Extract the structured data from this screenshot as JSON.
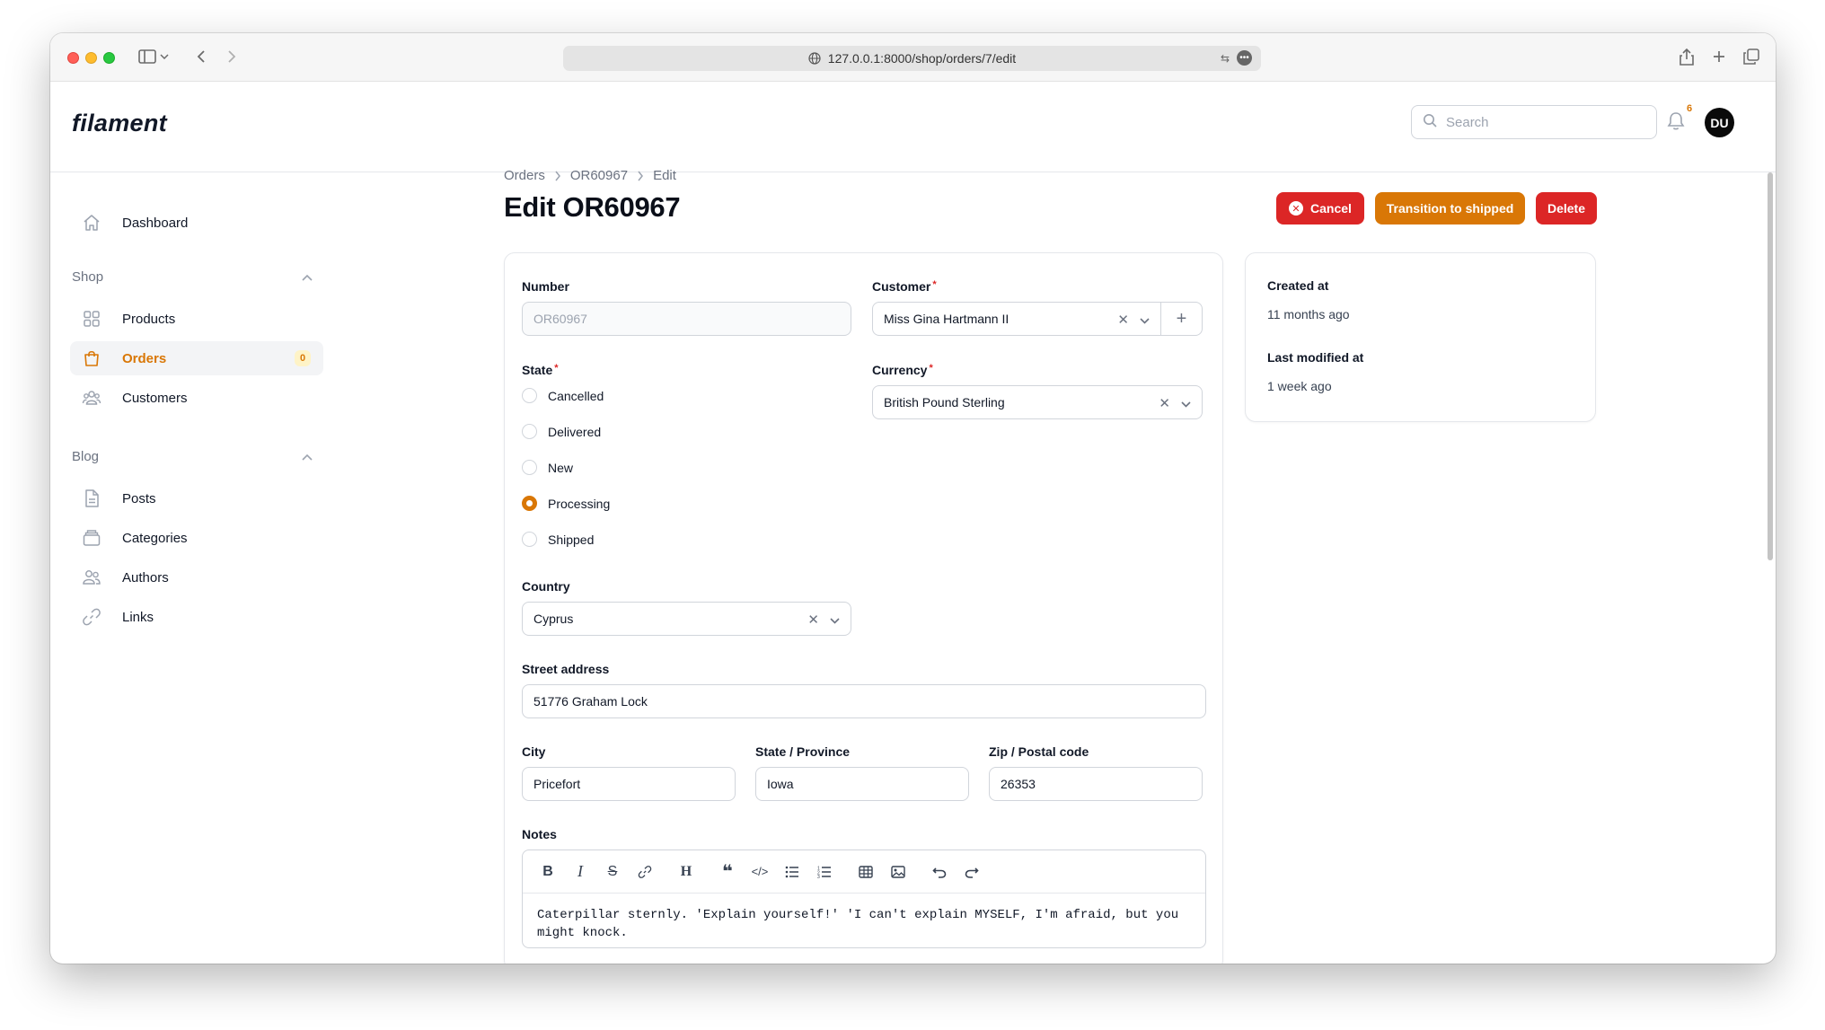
{
  "browser": {
    "url": "127.0.0.1:8000/shop/orders/7/edit"
  },
  "app": {
    "logo": "filament",
    "search_placeholder": "Search",
    "notification_count": "6",
    "avatar_initials": "DU"
  },
  "sidebar": {
    "dashboard": "Dashboard",
    "groups": {
      "shop": "Shop",
      "blog": "Blog"
    },
    "shop_items": [
      {
        "label": "Products",
        "icon": "grid-icon"
      },
      {
        "label": "Orders",
        "icon": "shopping-bag-icon",
        "badge": "0",
        "active": true
      },
      {
        "label": "Customers",
        "icon": "users-icon"
      }
    ],
    "blog_items": [
      {
        "label": "Posts",
        "icon": "document-icon"
      },
      {
        "label": "Categories",
        "icon": "folder-icon"
      },
      {
        "label": "Authors",
        "icon": "user-group-icon"
      },
      {
        "label": "Links",
        "icon": "link-icon"
      }
    ]
  },
  "page": {
    "breadcrumb": [
      "Orders",
      "OR60967",
      "Edit"
    ],
    "title": "Edit OR60967",
    "actions": {
      "cancel": "Cancel",
      "ship": "Transition to shipped",
      "delete": "Delete"
    }
  },
  "form": {
    "number_label": "Number",
    "number_value": "OR60967",
    "customer_label": "Customer",
    "customer_value": "Miss Gina Hartmann II",
    "state_label": "State",
    "state_options": [
      "Cancelled",
      "Delivered",
      "New",
      "Processing",
      "Shipped"
    ],
    "state_selected": "Processing",
    "currency_label": "Currency",
    "currency_value": "British Pound Sterling",
    "country_label": "Country",
    "country_value": "Cyprus",
    "street_label": "Street address",
    "street_value": "51776 Graham Lock",
    "city_label": "City",
    "city_value": "Pricefort",
    "province_label": "State / Province",
    "province_value": "Iowa",
    "zip_label": "Zip / Postal code",
    "zip_value": "26353",
    "notes_label": "Notes",
    "notes_value": "Caterpillar sternly. 'Explain yourself!' 'I can't explain MYSELF, I'm afraid, but you might knock."
  },
  "meta": {
    "created_label": "Created at",
    "created_value": "11 months ago",
    "modified_label": "Last modified at",
    "modified_value": "1 week ago"
  },
  "colors": {
    "primary": "#d97706",
    "danger": "#dc2626"
  }
}
